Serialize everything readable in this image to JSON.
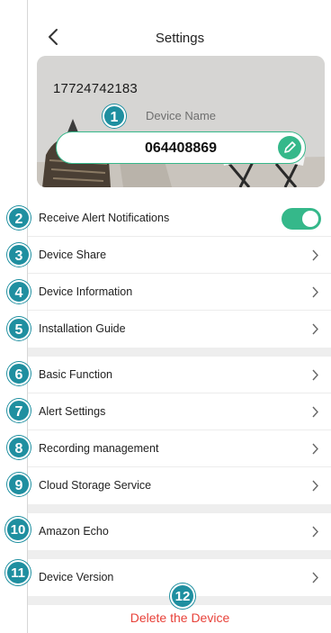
{
  "header": {
    "title": "Settings"
  },
  "device": {
    "id": "17724742183",
    "name_label": "Device Name",
    "name_value": "064408869"
  },
  "rows": [
    {
      "label": "Receive Alert Notifications",
      "toggle": true
    },
    {
      "label": "Device Share"
    },
    {
      "label": "Device Information"
    },
    {
      "label": "Installation Guide"
    },
    {
      "label": "Basic Function"
    },
    {
      "label": "Alert Settings"
    },
    {
      "label": "Recording management"
    },
    {
      "label": "Cloud Storage Service"
    },
    {
      "label": "Amazon Echo"
    },
    {
      "label": "Device Version"
    }
  ],
  "delete_label": "Delete the Device",
  "badges": [
    "1",
    "2",
    "3",
    "4",
    "5",
    "6",
    "7",
    "8",
    "9",
    "10",
    "11",
    "12"
  ],
  "colors": {
    "accent": "#35b88a",
    "badge": "#1f8fa0",
    "danger": "#e8423a"
  }
}
